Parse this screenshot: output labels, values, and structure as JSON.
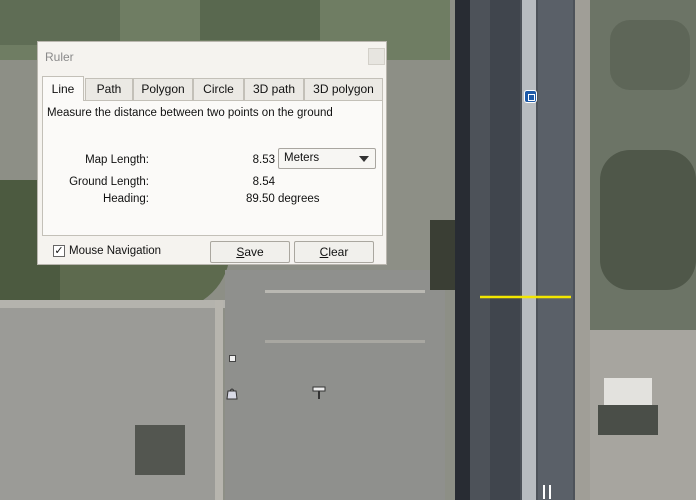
{
  "dialog": {
    "title": "Ruler",
    "tabs": [
      {
        "label": "Line"
      },
      {
        "label": "Path"
      },
      {
        "label": "Polygon"
      },
      {
        "label": "Circle"
      },
      {
        "label": "3D path"
      },
      {
        "label": "3D polygon"
      }
    ],
    "active_tab": "Line",
    "description": "Measure the distance between two points on the ground",
    "map_length": {
      "label": "Map Length:",
      "value": "8.53"
    },
    "units": {
      "selected": "Meters"
    },
    "ground_length": {
      "label": "Ground Length:",
      "value": "8.54"
    },
    "heading": {
      "label": "Heading:",
      "value": "89.50 degrees"
    },
    "mouse_navigation": {
      "label": "Mouse Navigation",
      "checked": true,
      "mark": "✓"
    },
    "save_button": {
      "label_prefix": "",
      "label_underlined": "S",
      "label_rest": "ave"
    },
    "clear_button": {
      "label_prefix": "",
      "label_underlined": "C",
      "label_rest": "lear"
    }
  },
  "map": {
    "measure_line_color": "#f2e600",
    "icons": [
      "bus-stop-icon",
      "square-marker-icon",
      "shopping-bag-icon",
      "hair-salon-icon",
      "restaurant-icon"
    ]
  }
}
